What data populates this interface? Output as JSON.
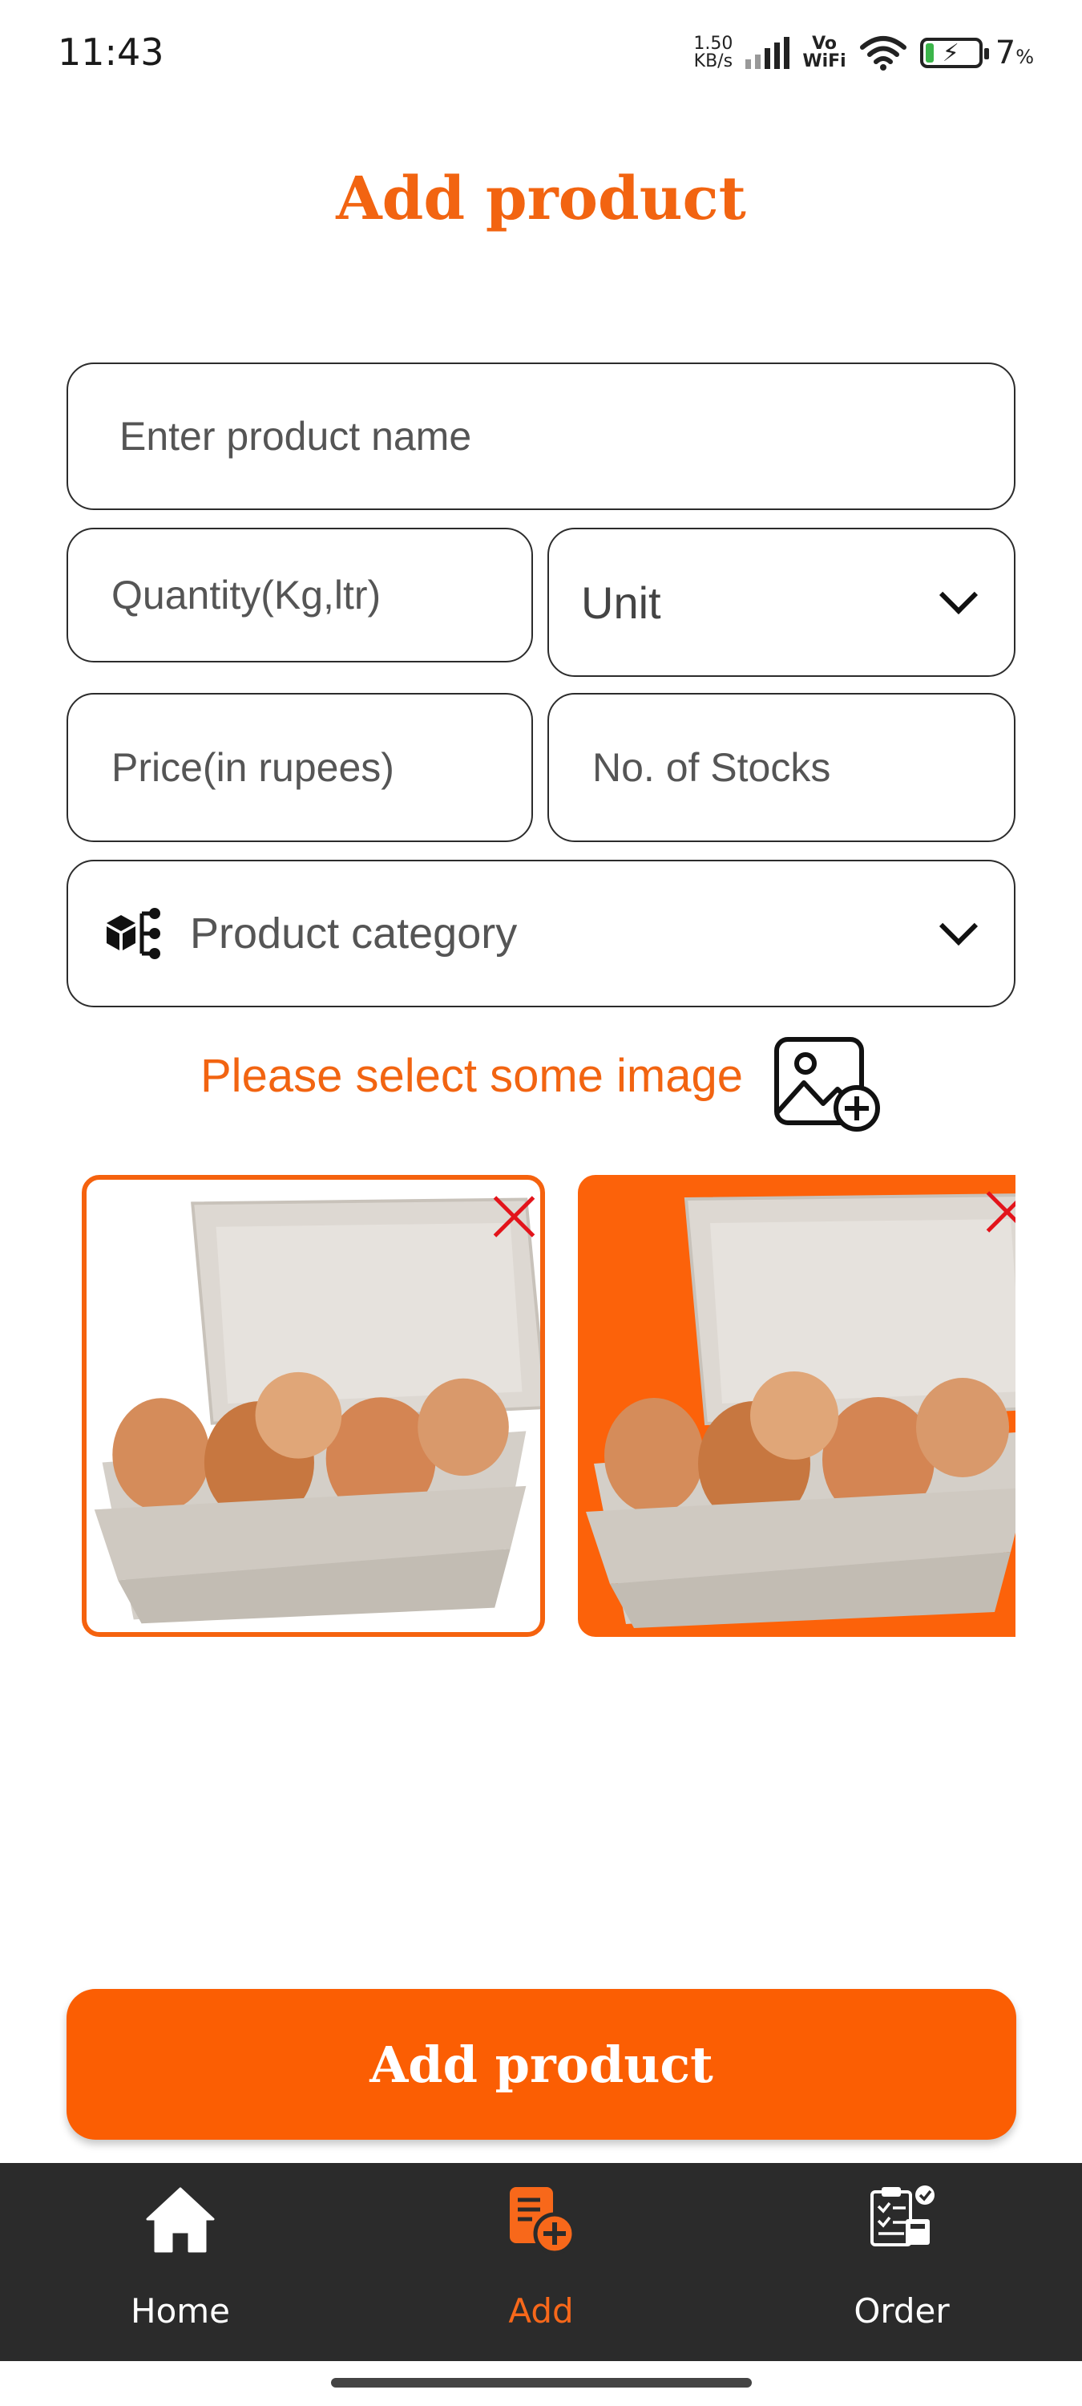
{
  "status_bar": {
    "time": "11:43",
    "net_speed_value": "1.50",
    "net_speed_unit": "KB/s",
    "vowifi_top": "Vo",
    "vowifi_bottom": "WiFi",
    "battery_percent": "7",
    "battery_unit": "%"
  },
  "page": {
    "title": "Add product"
  },
  "form": {
    "product_name_placeholder": "Enter product name",
    "quantity_placeholder": "Quantity(Kg,ltr)",
    "unit_value": "Unit",
    "price_placeholder": "Price(in rupees)",
    "stocks_placeholder": "No. of Stocks",
    "category_placeholder": "Product category"
  },
  "image_picker": {
    "prompt": "Please select some image",
    "thumbnails": [
      {
        "content": "egg carton",
        "background": "#ffffff"
      },
      {
        "content": "egg carton",
        "background": "#fc620a"
      }
    ]
  },
  "submit": {
    "label": "Add product"
  },
  "bottom_nav": {
    "items": [
      {
        "label": "Home",
        "icon": "home-icon",
        "active": false
      },
      {
        "label": "Add",
        "icon": "add-document-icon",
        "active": true
      },
      {
        "label": "Order",
        "icon": "order-clipboard-icon",
        "active": false
      }
    ]
  },
  "colors": {
    "accent": "#f26411",
    "button": "#fb5e03",
    "nav_background": "#2b2b2b",
    "remove": "#e3141b"
  }
}
